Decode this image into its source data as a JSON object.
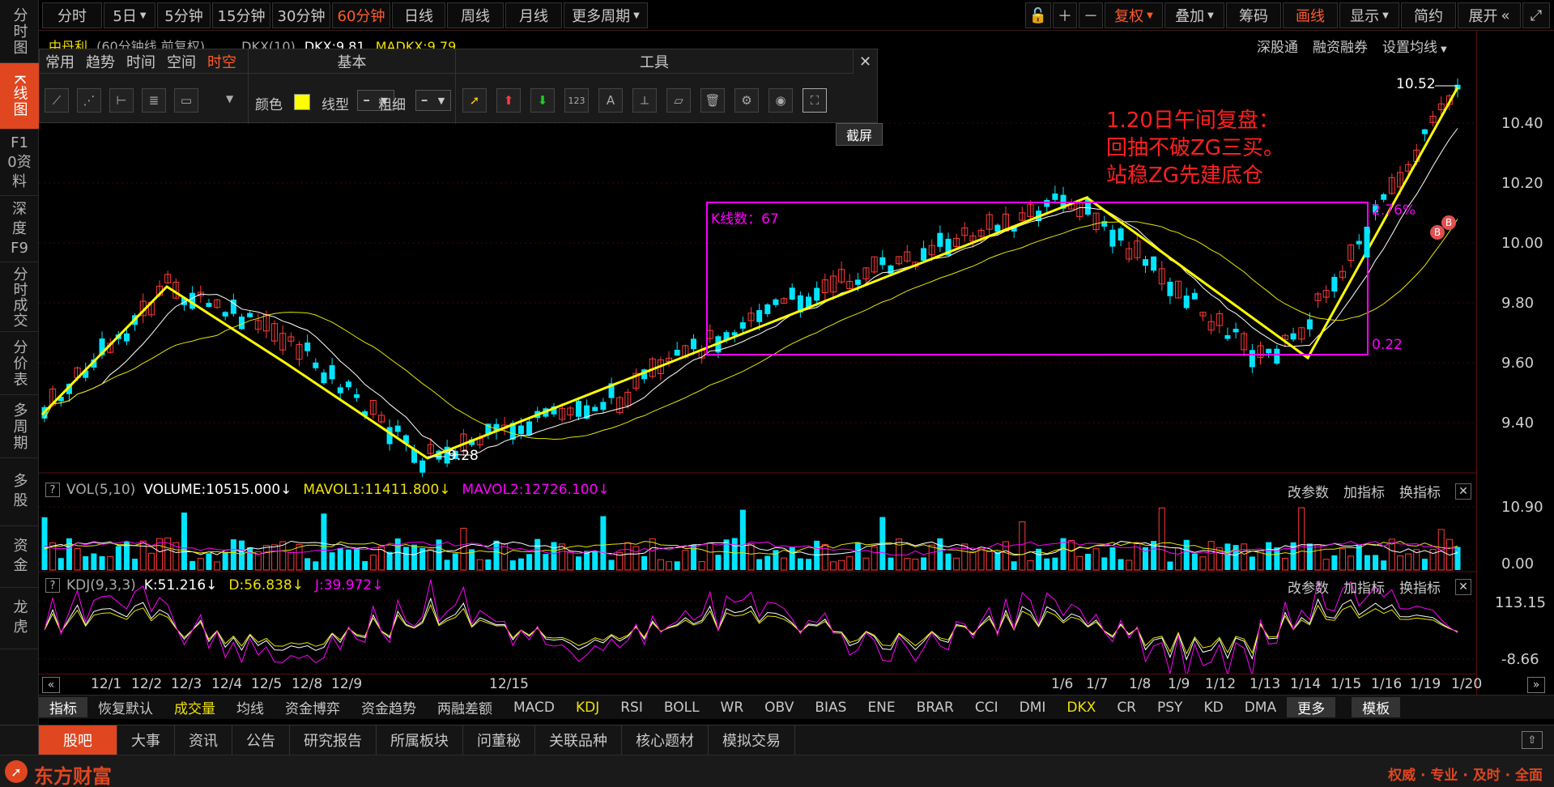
{
  "sidebar": {
    "items": [
      {
        "label": "分时图",
        "active": false
      },
      {
        "label": "K线图",
        "active": true
      },
      {
        "label": "F10资料",
        "active": false
      },
      {
        "label": "深度F9",
        "active": false
      },
      {
        "label": "分时成交",
        "active": false
      },
      {
        "label": "分价表",
        "active": false
      },
      {
        "label": "多周期",
        "active": false
      },
      {
        "label": "多股",
        "active": false
      },
      {
        "label": "资金",
        "active": false
      },
      {
        "label": "龙虎",
        "active": false
      }
    ]
  },
  "periods": [
    "分时",
    "5日",
    "5分钟",
    "15分钟",
    "30分钟",
    "60分钟",
    "日线",
    "周线",
    "月线",
    "更多周期"
  ],
  "active_period": "60分钟",
  "right_tools": [
    "复权",
    "叠加",
    "筹码",
    "画线",
    "显示",
    "简约",
    "展开"
  ],
  "stock": {
    "name": "中丹利",
    "desc": "(60分钟线 前复权)",
    "dkx_label": "DKX(10)",
    "dkx": "DKX:9.81",
    "madkx": "MADKX:9.79"
  },
  "right_links": [
    "深股通",
    "融资融券",
    "设置均线"
  ],
  "tool_panel": {
    "tabs": [
      "常用",
      "趋势",
      "时间",
      "空间",
      "时空"
    ],
    "active_tab": "时空",
    "basic_title": "基本",
    "tools_title": "工具",
    "color_label": "颜色",
    "line_label": "线型",
    "width_label": "粗细",
    "tooltip": "截屏",
    "highlight_color": "#ffff00"
  },
  "annotations": {
    "note_lines": [
      "1.20日午间复盘：",
      "回抽不破ZG三买。",
      "站稳ZG先建底仓"
    ],
    "box_label": "K线数：67",
    "pct_label": "2.76%",
    "diff_label": "0.22",
    "high_label": "10.52",
    "low_label": "9.28",
    "marker": "B"
  },
  "price_axis": [
    "10.40",
    "10.20",
    "10.00",
    "9.80",
    "9.60",
    "9.40"
  ],
  "vol": {
    "title": "VOL(5,10)",
    "volume": "VOLUME:10515.000",
    "mavol1": "MAVOL1:11411.800",
    "mavol2": "MAVOL2:12726.100",
    "axis_top": "10.90",
    "axis_bottom": "0.00"
  },
  "kdj": {
    "title": "KDJ(9,3,3)",
    "k": "K:51.216",
    "d": "D:56.838",
    "j": "J:39.972",
    "axis_top": "113.15",
    "axis_bottom": "-8.66"
  },
  "panel_links": [
    "改参数",
    "加指标",
    "换指标"
  ],
  "xaxis_labels": [
    "12/1",
    "12/2",
    "12/3",
    "12/4",
    "12/5",
    "12/8",
    "12/9",
    "12/15",
    "1/6",
    "1/7",
    "1/8",
    "1/9",
    "1/12",
    "1/13",
    "1/14",
    "1/15",
    "1/16",
    "1/19",
    "1/20"
  ],
  "indicators": [
    "指标",
    "恢复默认",
    "成交量",
    "均线",
    "资金博弈",
    "资金趋势",
    "两融差额",
    "MACD",
    "KDJ",
    "RSI",
    "BOLL",
    "WR",
    "OBV",
    "BIAS",
    "ENE",
    "BRAR",
    "CCI",
    "DMI",
    "DKX",
    "CR",
    "PSY",
    "KD",
    "DMA",
    "更多",
    "模板"
  ],
  "bottom_tabs": [
    "股吧",
    "大事",
    "资讯",
    "公告",
    "研究报告",
    "所属板块",
    "问董秘",
    "关联品种",
    "核心题材",
    "模拟交易"
  ],
  "footer": {
    "brand": "东方财富",
    "slogan": "权威 · 专业 · 及时 · 全面"
  },
  "colors": {
    "up": "#ff3a3a",
    "down": "#00e5ff",
    "accent": "#ff5a2a",
    "trend": "#ffff00",
    "box": "#ff00ff"
  }
}
